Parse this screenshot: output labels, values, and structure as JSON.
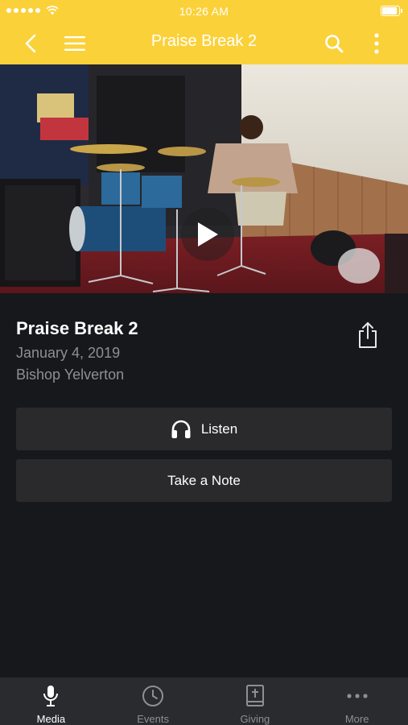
{
  "status_bar": {
    "time": "10:26 AM"
  },
  "nav": {
    "title": "Praise Break 2"
  },
  "sermon": {
    "title": "Praise Break 2",
    "date": "January 4, 2019",
    "speaker": "Bishop Yelverton"
  },
  "actions": {
    "listen_label": "Listen",
    "note_label": "Take a Note"
  },
  "tabs": [
    {
      "label": "Media",
      "icon": "microphone-icon",
      "active": true
    },
    {
      "label": "Events",
      "icon": "clock-icon",
      "active": false
    },
    {
      "label": "Giving",
      "icon": "bible-icon",
      "active": false
    },
    {
      "label": "More",
      "icon": "ellipsis-icon",
      "active": false
    }
  ],
  "colors": {
    "accent": "#fbd13a",
    "background": "#17181b",
    "button": "#2a2a2c",
    "tabbar": "#2a2b2e",
    "muted_text": "#8e8f94"
  }
}
